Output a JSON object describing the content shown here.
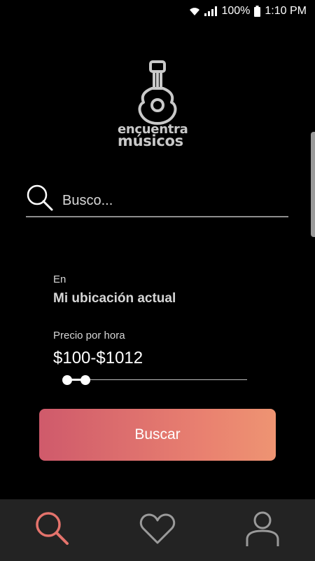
{
  "status_bar": {
    "battery": "100%",
    "time": "1:10 PM"
  },
  "logo": {
    "line1": "encuentra",
    "line2": "músicos"
  },
  "search": {
    "placeholder": "Busco..."
  },
  "location": {
    "label": "En",
    "value": "Mi ubicación actual"
  },
  "price": {
    "label": "Precio por hora",
    "value": "$100-$1012",
    "slider_min_fraction": 0.0,
    "slider_max_fraction": 0.1
  },
  "primary_button": {
    "label": "Buscar",
    "gradient_start": "#cf5a6b",
    "gradient_end": "#ee9472"
  },
  "bottom_nav": {
    "items": [
      {
        "icon": "search-icon",
        "active": true,
        "color": "#e4736c"
      },
      {
        "icon": "heart-icon",
        "active": false,
        "color": "#9a9a9a"
      },
      {
        "icon": "person-icon",
        "active": false,
        "color": "#9a9a9a"
      }
    ]
  }
}
